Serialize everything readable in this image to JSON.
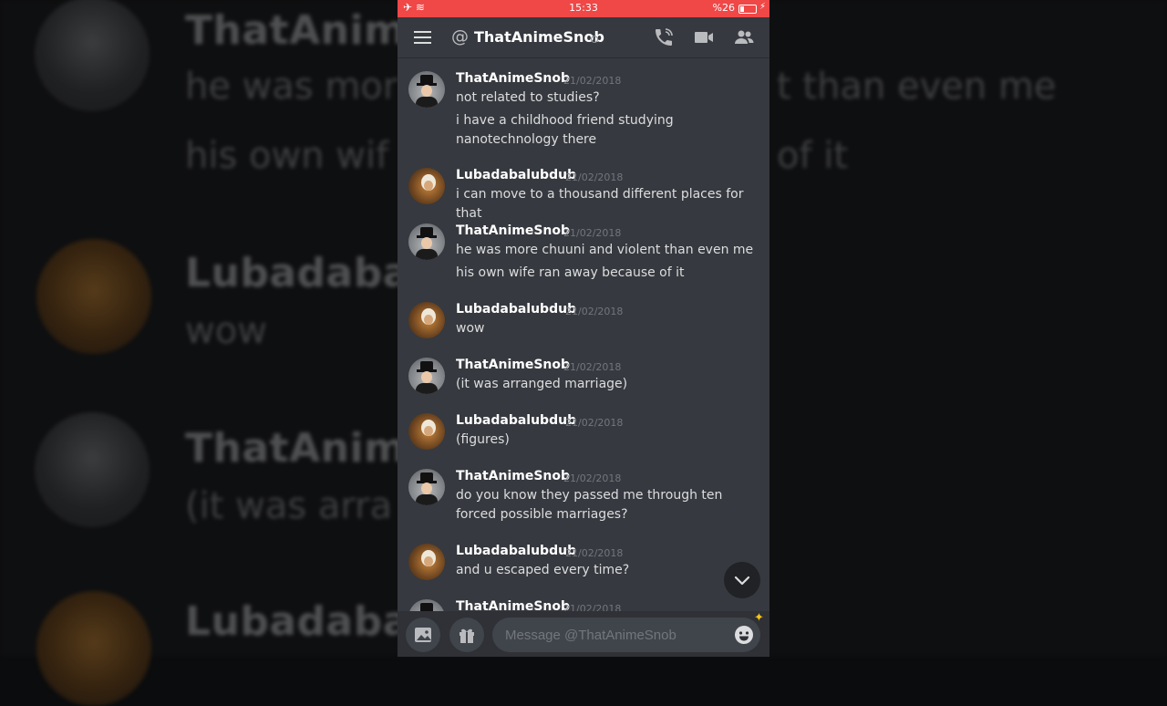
{
  "status_bar": {
    "time": "15:33",
    "battery": "%26"
  },
  "header": {
    "title": "ThatAnimeSnob"
  },
  "background_copy": {
    "rows": [
      {
        "name": "ThatAnimeSnob",
        "lines": [
          "he was mor",
          "his own wif"
        ],
        "lines_right": [
          "t than even me",
          "of it"
        ]
      },
      {
        "name": "Lubadabalu",
        "lines": [
          "wow"
        ]
      },
      {
        "name": "ThatAnime",
        "lines": [
          "(it was arra"
        ]
      },
      {
        "name": "Lubadabalu",
        "lines": []
      }
    ]
  },
  "messages": [
    {
      "author": "ThatAnimeSnob",
      "avatar": "snob",
      "date": "21/02/2018",
      "lines": [
        "not related to studies?",
        "i have a childhood friend studying nanotechnology there"
      ]
    },
    {
      "author": "Lubadabalubdub",
      "avatar": "luba",
      "date": "21/02/2018",
      "lines": [
        "i can move to a thousand different places for that"
      ]
    },
    {
      "author": "ThatAnimeSnob",
      "avatar": "snob",
      "date": "21/02/2018",
      "lines": [
        "he was more chuuni and violent than even me",
        "his own wife ran away because of it"
      ]
    },
    {
      "author": "Lubadabalubdub",
      "avatar": "luba",
      "date": "21/02/2018",
      "lines": [
        "wow"
      ]
    },
    {
      "author": "ThatAnimeSnob",
      "avatar": "snob",
      "date": "21/02/2018",
      "lines": [
        "(it was arranged marriage)"
      ]
    },
    {
      "author": "Lubadabalubdub",
      "avatar": "luba",
      "date": "21/02/2018",
      "lines": [
        "(figures)"
      ]
    },
    {
      "author": "ThatAnimeSnob",
      "avatar": "snob",
      "date": "21/02/2018",
      "lines": [
        "do you know they passed me through ten forced possible marriages?"
      ]
    },
    {
      "author": "Lubadabalubdub",
      "avatar": "luba",
      "date": "21/02/2018",
      "lines": [
        "and u escaped every time?"
      ]
    },
    {
      "author": "ThatAnimeSnob",
      "avatar": "snob",
      "date": "21/02/2018",
      "lines": []
    }
  ],
  "composer": {
    "placeholder": "Message @ThatAnimeSnob"
  },
  "colors": {
    "status_bar": "#f04747",
    "background": "#36393f",
    "composer": "#2f3136"
  }
}
